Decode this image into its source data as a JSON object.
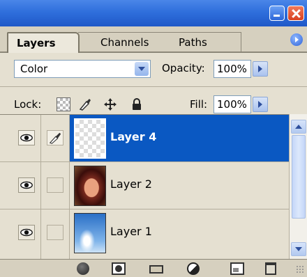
{
  "tabs": [
    "Layers",
    "Channels",
    "Paths"
  ],
  "blend_mode": "Color",
  "opacity_label": "Opacity:",
  "opacity_value": "100%",
  "lock_label": "Lock:",
  "fill_label": "Fill:",
  "fill_value": "100%",
  "layers": [
    {
      "name": "Layer 4",
      "selected": true
    },
    {
      "name": "Layer 2",
      "selected": false
    },
    {
      "name": "Layer 1",
      "selected": false
    }
  ],
  "colors": {
    "selection": "#0a58c2",
    "titlebar": "#2f6fdc"
  }
}
